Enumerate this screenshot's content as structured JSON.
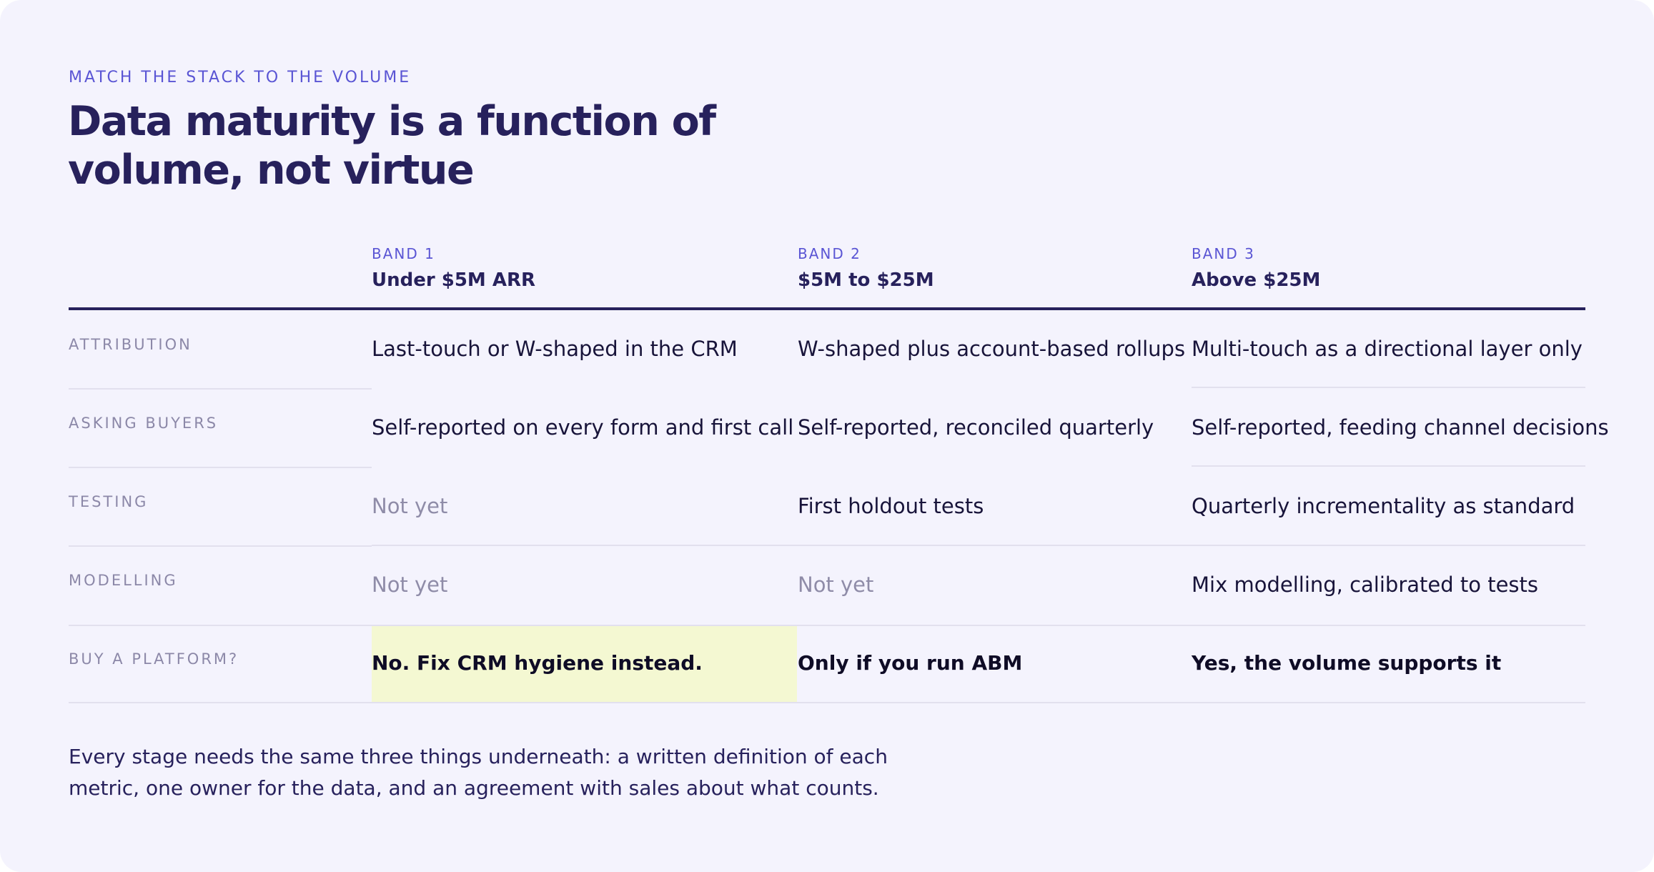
{
  "eyebrow": "MATCH THE STACK TO THE VOLUME",
  "title": "Data maturity is a function of volume, not virtue",
  "bands": [
    {
      "number": "BAND 1",
      "name": "Under $5M ARR"
    },
    {
      "number": "BAND 2",
      "name": "$5M to $25M"
    },
    {
      "number": "BAND 3",
      "name": "Above $25M"
    }
  ],
  "rows": [
    {
      "label": "ATTRIBUTION",
      "cells": [
        "Last-touch or W-shaped in the CRM",
        "W-shaped plus account-based rollups",
        "Multi-touch as a directional layer only"
      ]
    },
    {
      "label": "ASKING BUYERS",
      "cells": [
        "Self-reported on every form and first call",
        "Self-reported, reconciled quarterly",
        "Self-reported, feeding channel decisions"
      ]
    },
    {
      "label": "TESTING",
      "cells": [
        "Not yet",
        "First holdout tests",
        "Quarterly incrementality as standard"
      ]
    },
    {
      "label": "MODELLING",
      "cells": [
        "Not yet",
        "Not yet",
        "Mix modelling, calibrated to tests"
      ]
    },
    {
      "label": "BUY A PLATFORM?",
      "cells": [
        "No. Fix CRM hygiene instead.",
        "Only if you run ABM",
        "Yes, the volume supports it"
      ]
    }
  ],
  "footnote": "Every stage needs the same three things underneath: a written definition of each metric, one owner for the data, and an agreement with sales about what counts.",
  "colors": {
    "background": "#f4f3fd",
    "accent": "#5a55d4",
    "heading": "#27215c",
    "muted": "#8f8ca8",
    "highlight": "#f4f8d2"
  }
}
